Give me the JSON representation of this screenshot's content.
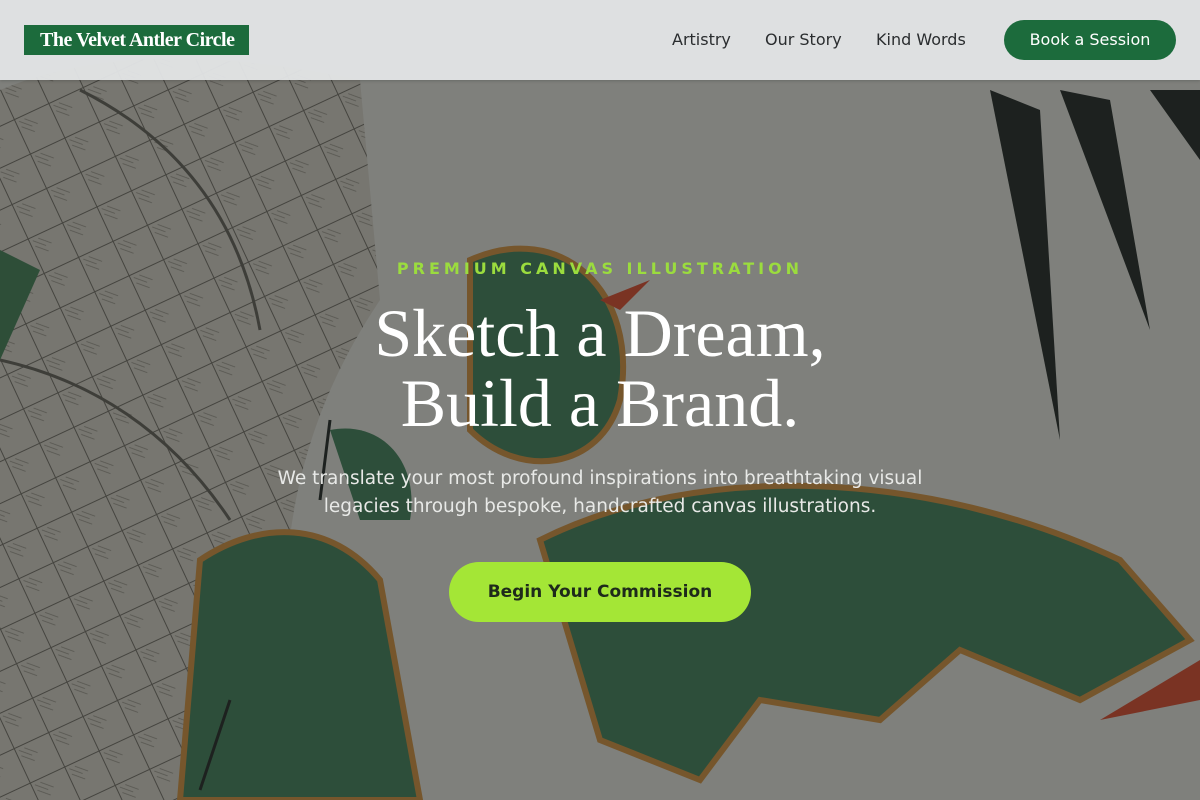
{
  "brand": {
    "name": "The Velvet Antler Circle"
  },
  "nav": {
    "links": [
      {
        "label": "Artistry"
      },
      {
        "label": "Our Story"
      },
      {
        "label": "Kind Words"
      }
    ],
    "cta_label": "Book a Session"
  },
  "hero": {
    "eyebrow": "PREMIUM CANVAS ILLUSTRATION",
    "headline_line1": "Sketch a Dream,",
    "headline_line2": "Build a Brand.",
    "subtext": "We translate your most profound inspirations into breathtaking visual legacies through bespoke, handcrafted canvas illustrations.",
    "cta_label": "Begin Your Commission"
  },
  "colors": {
    "brand_green": "#1c6b3c",
    "accent_lime": "#a4e636",
    "eyebrow_lime": "#9bdc3e"
  }
}
